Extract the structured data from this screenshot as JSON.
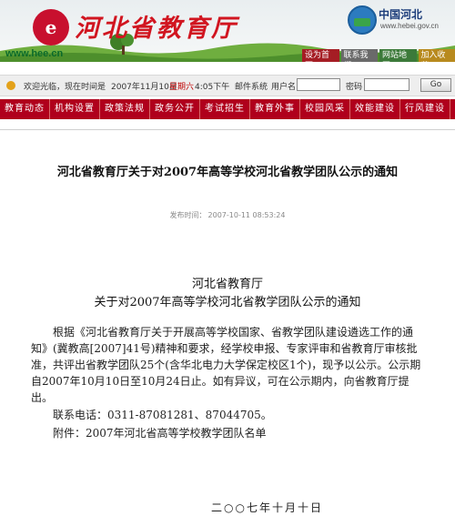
{
  "header": {
    "logo_mark": "e",
    "site_name": "河北省教育厅",
    "site_url": "www.hee.cn",
    "gov_title": "中国河北",
    "gov_url": "www.hebei.gov.cn",
    "quick_links": [
      "设为首页",
      "联系我们",
      "网站地图",
      "加入收藏"
    ]
  },
  "status_bar": {
    "welcome": "欢迎光临，现在时间是",
    "date": "2007年11月10日",
    "weekday": "星期六",
    "time": "4:05下午",
    "mail_system": "邮件系统",
    "username_label": "用户名",
    "password_label": "密码",
    "go_label": "Go"
  },
  "nav": {
    "items": [
      "教育动态",
      "机构设置",
      "政策法规",
      "政务公开",
      "考试招生",
      "教育外事",
      "校园风采",
      "效能建设",
      "行风建设"
    ]
  },
  "article": {
    "title": "河北省教育厅关于对2007年高等学校河北省教学团队公示的通知",
    "publish_label": "发布时间：",
    "publish_time": "2007-10-11 08:53:24",
    "doc_header_line1": "河北省教育厅",
    "doc_header_line2": "关于对2007年高等学校河北省教学团队公示的通知",
    "body": "根据《河北省教育厅关于开展高等学校国家、省教学团队建设遴选工作的通知》(冀教高[2007]41号)精神和要求，经学校申报、专家评审和省教育厅审核批准，共评出省教学团队25个(含华北电力大学保定校区1个)，现予以公示。公示期自2007年10月10日至10月24日止。如有异议，可在公示期内，向省教育厅提出。",
    "contact": "联系电话：0311-87081281、87044705。",
    "attachment": "附件：2007年河北省高等学校教学团队名单",
    "sign_date": "二○○七年十月十日"
  }
}
